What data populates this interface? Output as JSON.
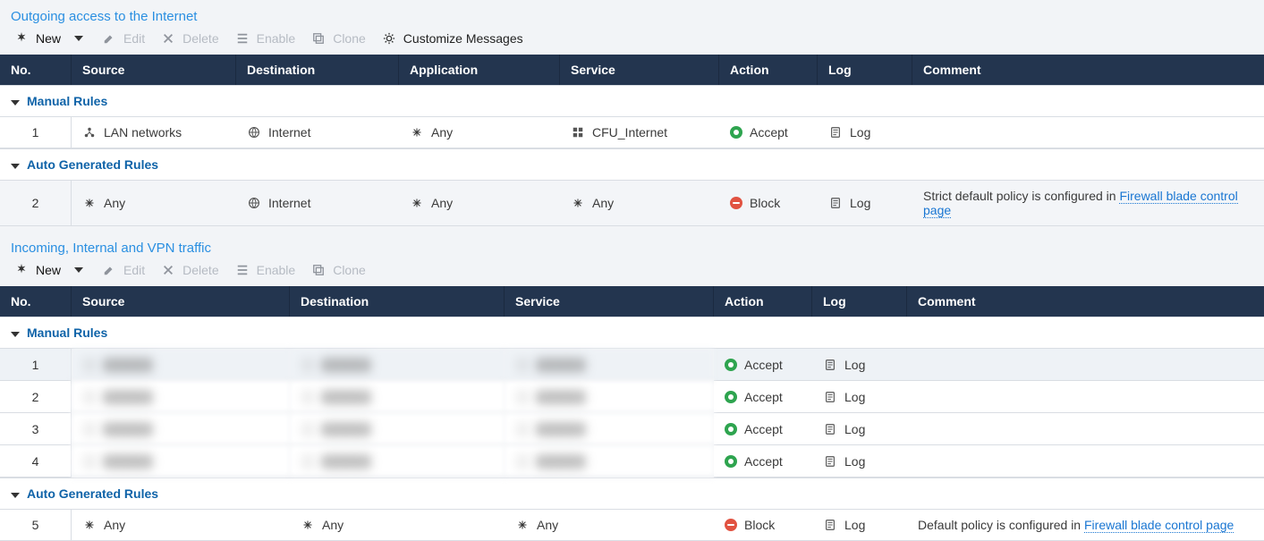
{
  "sections": {
    "outgoing": {
      "title": "Outgoing access to the Internet",
      "toolbar": {
        "new": "New",
        "edit": "Edit",
        "delete": "Delete",
        "enable": "Enable",
        "clone": "Clone",
        "customize": "Customize Messages"
      },
      "columns": {
        "no": "No.",
        "source": "Source",
        "destination": "Destination",
        "application": "Application",
        "service": "Service",
        "action": "Action",
        "log": "Log",
        "comment": "Comment"
      },
      "groups": {
        "manual": "Manual Rules",
        "auto": "Auto Generated Rules"
      },
      "rows": {
        "r1": {
          "no": "1",
          "source": "LAN networks",
          "destination": "Internet",
          "application": "Any",
          "service": "CFU_Internet",
          "action": "Accept",
          "log": "Log",
          "comment": ""
        },
        "r2": {
          "no": "2",
          "source": "Any",
          "destination": "Internet",
          "application": "Any",
          "service": "Any",
          "action": "Block",
          "log": "Log",
          "comment_prefix": "Strict default policy is configured in ",
          "comment_link": "Firewall blade control page"
        }
      }
    },
    "incoming": {
      "title": "Incoming, Internal and VPN traffic",
      "toolbar": {
        "new": "New",
        "edit": "Edit",
        "delete": "Delete",
        "enable": "Enable",
        "clone": "Clone"
      },
      "columns": {
        "no": "No.",
        "source": "Source",
        "destination": "Destination",
        "service": "Service",
        "action": "Action",
        "log": "Log",
        "comment": "Comment"
      },
      "groups": {
        "manual": "Manual Rules",
        "auto": "Auto Generated Rules"
      },
      "rows": {
        "r1": {
          "no": "1",
          "action": "Accept",
          "log": "Log"
        },
        "r2": {
          "no": "2",
          "action": "Accept",
          "log": "Log"
        },
        "r3": {
          "no": "3",
          "action": "Accept",
          "log": "Log"
        },
        "r4": {
          "no": "4",
          "action": "Accept",
          "log": "Log"
        },
        "r5": {
          "no": "5",
          "source": "Any",
          "destination": "Any",
          "service": "Any",
          "action": "Block",
          "log": "Log",
          "comment_prefix": "Default policy is configured in ",
          "comment_link": "Firewall blade control page"
        }
      }
    }
  },
  "icons": {
    "star": "new-star-icon",
    "edit": "pencil-icon",
    "delete": "x-icon",
    "enable": "list-icon",
    "clone": "clone-icon",
    "gear": "gear-icon",
    "globe": "globe-icon",
    "objects": "objects-icon",
    "asterisk": "asterisk-icon",
    "doc": "notes-icon",
    "net": "net-icon",
    "caret": "caret-down-icon",
    "chev": "chevron-down-icon"
  },
  "colors": {
    "header": "#23354f",
    "title": "#2a8fe1",
    "link": "#1976d2",
    "green": "#2ea44f",
    "red": "#e15241"
  }
}
